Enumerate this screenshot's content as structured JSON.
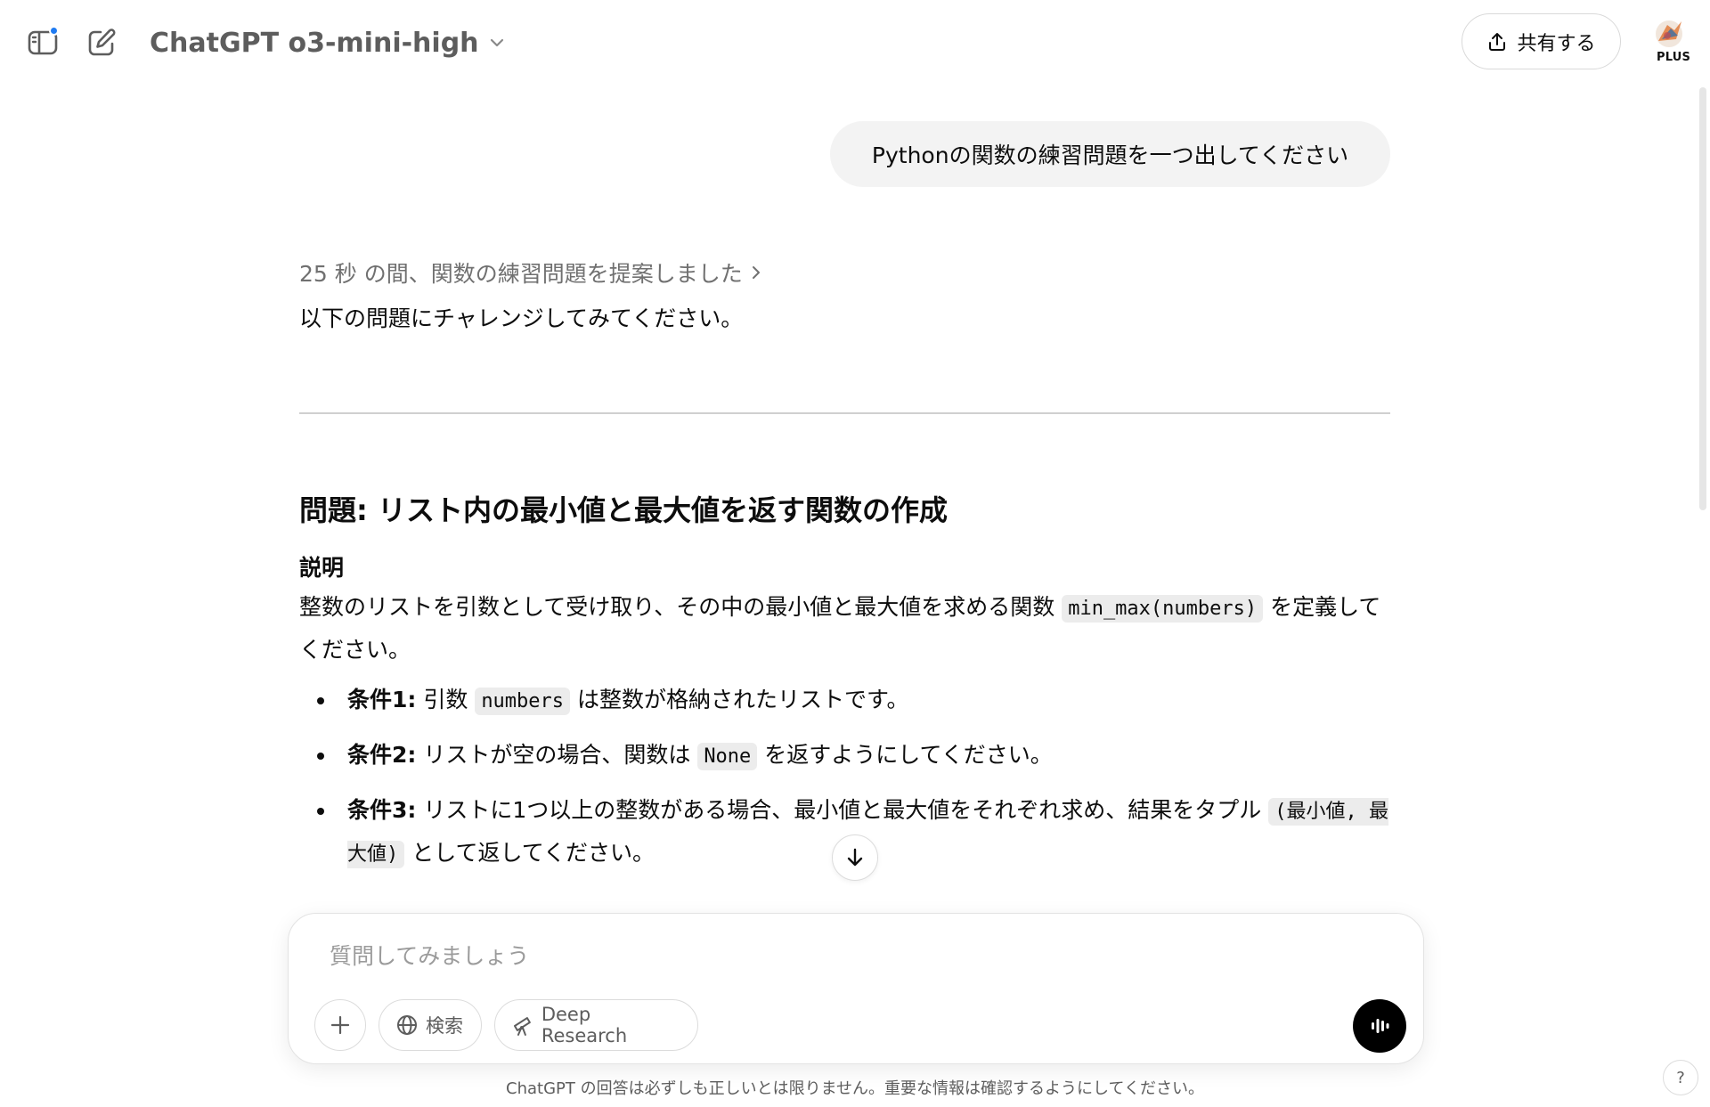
{
  "header": {
    "model_name": "ChatGPT o3-mini-high",
    "share_label": "共有する",
    "avatar_badge": "PLUS",
    "icons": [
      "sidebar-toggle-icon",
      "new-chat-icon",
      "chevron-down-icon",
      "share-icon"
    ]
  },
  "conversation": {
    "user_message": "Pythonの関数の練習問題を一つ出してください",
    "reasoning_summary": "25 秒 の間、関数の練習問題を提案しました",
    "intro": "以下の問題にチャレンジしてみてください。",
    "problem_title": "問題: リスト内の最小値と最大値を返す関数の作成",
    "section_label": "説明",
    "description": {
      "before": "整数のリストを引数として受け取り、その中の最小値と最大値を求める関数 ",
      "code": "min_max(numbers)",
      "after": " を定義してください。"
    },
    "conditions": [
      {
        "label": "条件1:",
        "before": " 引数 ",
        "code": "numbers",
        "after": " は整数が格納されたリストです。"
      },
      {
        "label": "条件2:",
        "before": " リストが空の場合、関数は ",
        "code": "None",
        "after": " を返すようにしてください。"
      },
      {
        "label": "条件3:",
        "before": " リストに1つ以上の整数がある場合、最小値と最大値をそれぞれ求め、結果をタプル ",
        "code": "(最小値, 最大値)",
        "after": " として返してください。"
      }
    ]
  },
  "composer": {
    "placeholder": "質問してみましょう",
    "search_label": "検索",
    "research_label": "Deep Research"
  },
  "footer": {
    "disclaimer": "ChatGPT の回答は必ずしも正しいとは限りません。重要な情報は確認するようにしてください。",
    "help_label": "?"
  },
  "colors": {
    "notification_dot": "#1f7bf2",
    "bubble_bg": "#f3f3f3",
    "voice_button": "#000000"
  }
}
